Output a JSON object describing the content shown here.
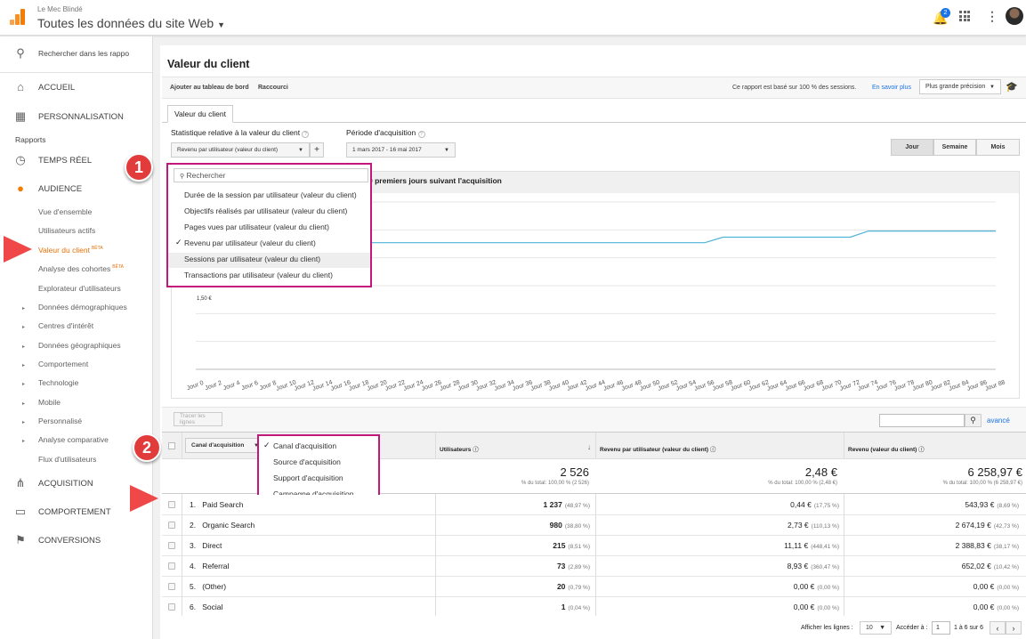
{
  "header": {
    "account": "Le Mec Blindé",
    "property": "Toutes les données du site Web",
    "notif_count": "2"
  },
  "sidebar": {
    "search_placeholder": "Rechercher dans les rappo",
    "accueil": "ACCUEIL",
    "personnalisation": "PERSONNALISATION",
    "rapports": "Rapports",
    "temps_reel": "TEMPS RÉEL",
    "audience": "AUDIENCE",
    "audience_items": [
      "Vue d'ensemble",
      "Utilisateurs actifs",
      "Valeur du client",
      "Analyse des cohortes",
      "Explorateur d'utilisateurs"
    ],
    "beta": "BÊTA",
    "collapsed": [
      "Données démographiques",
      "Centres d'intérêt",
      "Données géographiques",
      "Comportement",
      "Technologie",
      "Mobile",
      "Personnalisé",
      "Analyse comparative"
    ],
    "flux": "Flux d'utilisateurs",
    "acquisition": "ACQUISITION",
    "comportement": "COMPORTEMENT",
    "conversions": "CONVERSIONS"
  },
  "report": {
    "title": "Valeur du client",
    "add_dashboard": "Ajouter au tableau de bord",
    "shortcut": "Raccourci",
    "sessions_note": "Ce rapport est basé sur 100 % des sessions.",
    "learn_more": "En savoir plus",
    "precision": "Plus grande précision",
    "tab": "Valeur du client",
    "stat_label": "Statistique relative à la valeur du client",
    "stat_value": "Revenu par utilisateur (valeur du client)",
    "period_label": "Période d'acquisition",
    "period_value": "1 mars 2017 - 16 mai 2017",
    "granularity": [
      "Jour",
      "Semaine",
      "Mois"
    ],
    "chart_heading": "0 premiers jours suivant l'acquisition",
    "search_placeholder": "Rechercher",
    "metric_options": [
      "Durée de la session par utilisateur (valeur du client)",
      "Objectifs réalisés par utilisateur (valeur du client)",
      "Pages vues par utilisateur (valeur du client)",
      "Revenu par utilisateur (valeur du client)",
      "Sessions par utilisateur (valeur du client)",
      "Transactions par utilisateur (valeur du client)"
    ],
    "y_min_label": "1,50 €",
    "trace_lines": "Tracer les lignes",
    "advanced": "avancé"
  },
  "chart_data": {
    "type": "line",
    "x": [
      "Jour 0",
      "Jour 2",
      "Jour 4",
      "Jour 6",
      "Jour 8",
      "Jour 10",
      "Jour 12",
      "Jour 14",
      "Jour 16",
      "Jour 18",
      "Jour 20",
      "Jour 22",
      "Jour 24",
      "Jour 26",
      "Jour 28",
      "Jour 30",
      "Jour 32",
      "Jour 34",
      "Jour 36",
      "Jour 38",
      "Jour 40",
      "Jour 42",
      "Jour 44",
      "Jour 46",
      "Jour 48",
      "Jour 50",
      "Jour 52",
      "Jour 54",
      "Jour 56",
      "Jour 58",
      "Jour 60",
      "Jour 62",
      "Jour 64",
      "Jour 66",
      "Jour 68",
      "Jour 70",
      "Jour 72",
      "Jour 74",
      "Jour 76",
      "Jour 78",
      "Jour 80",
      "Jour 82",
      "Jour 84",
      "Jour 86",
      "Jour 88"
    ],
    "series": [
      {
        "values": [
          1.5,
          2.25,
          2.27,
          2.27,
          2.27,
          2.27,
          2.27,
          2.27,
          2.27,
          2.27,
          2.27,
          2.27,
          2.27,
          2.27,
          2.27,
          2.27,
          2.27,
          2.27,
          2.27,
          2.27,
          2.27,
          2.27,
          2.27,
          2.27,
          2.27,
          2.27,
          2.27,
          2.27,
          2.27,
          2.37,
          2.37,
          2.37,
          2.37,
          2.37,
          2.37,
          2.37,
          2.37,
          2.48,
          2.48,
          2.48,
          2.48,
          2.48,
          2.48,
          2.48,
          2.48
        ]
      }
    ],
    "grid": true
  },
  "table": {
    "dim_header": "Canal d'acquisition",
    "dim_options": [
      "Canal d'acquisition",
      "Source d'acquisition",
      "Support d'acquisition",
      "Campagne d'acquisition"
    ],
    "col_users": "Utilisateurs",
    "col_rpu": "Revenu par utilisateur (valeur du client)",
    "col_rev": "Revenu (valeur du client)",
    "tot_users": "2 526",
    "tot_users_sub": "% du total: 100,00 % (2 526)",
    "tot_rpu": "2,48 €",
    "tot_rpu_sub": "% du total: 100,00 % (2,48 €)",
    "tot_rev": "6 258,97 €",
    "tot_rev_sub": "% du total: 100,00 % (6 258,97 €)",
    "rows": [
      {
        "n": "1.",
        "name": "Paid Search",
        "users": "1 237",
        "up": "(48,97 %)",
        "rpu": "0,44 €",
        "rp": "(17,75 %)",
        "rev": "543,93 €",
        "vp": "(8,69 %)"
      },
      {
        "n": "2.",
        "name": "Organic Search",
        "users": "980",
        "up": "(38,80 %)",
        "rpu": "2,73 €",
        "rp": "(110,13 %)",
        "rev": "2 674,19 €",
        "vp": "(42,73 %)"
      },
      {
        "n": "3.",
        "name": "Direct",
        "users": "215",
        "up": "(8,51 %)",
        "rpu": "11,11 €",
        "rp": "(448,41 %)",
        "rev": "2 388,83 €",
        "vp": "(38,17 %)"
      },
      {
        "n": "4.",
        "name": "Referral",
        "users": "73",
        "up": "(2,89 %)",
        "rpu": "8,93 €",
        "rp": "(360,47 %)",
        "rev": "652,02 €",
        "vp": "(10,42 %)"
      },
      {
        "n": "5.",
        "name": "(Other)",
        "users": "20",
        "up": "(0,79 %)",
        "rpu": "0,00 €",
        "rp": "(0,00 %)",
        "rev": "0,00 €",
        "vp": "(0,00 %)"
      },
      {
        "n": "6.",
        "name": "Social",
        "users": "1",
        "up": "(0,04 %)",
        "rpu": "0,00 €",
        "rp": "(0,00 %)",
        "rev": "0,00 €",
        "vp": "(0,00 %)"
      }
    ],
    "show_rows_label": "Afficher les lignes :",
    "show_rows": "10",
    "goto_label": "Accéder à :",
    "goto": "1",
    "range": "1 à 6 sur 6"
  },
  "annotations": [
    "1",
    "2"
  ]
}
